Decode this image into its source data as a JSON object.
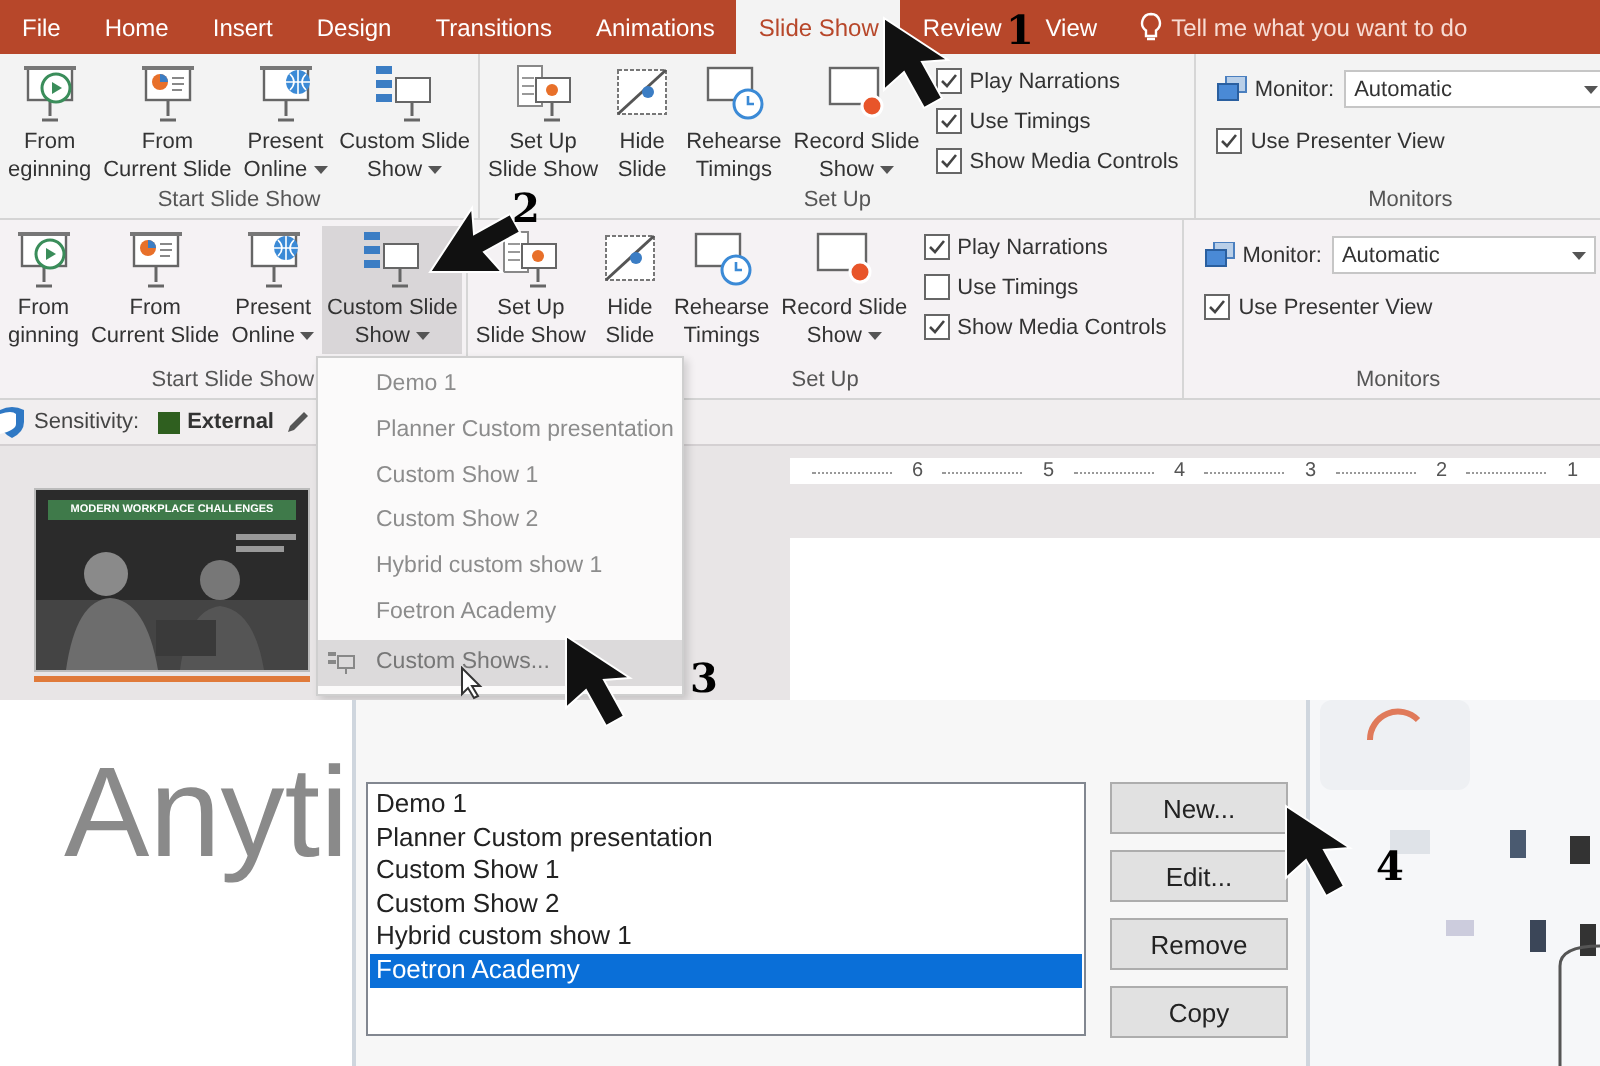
{
  "top_panel": {
    "tabs": [
      {
        "label": "File",
        "selected": false
      },
      {
        "label": "Home",
        "selected": false
      },
      {
        "label": "Insert",
        "selected": false
      },
      {
        "label": "Design",
        "selected": false
      },
      {
        "label": "Transitions",
        "selected": false
      },
      {
        "label": "Animations",
        "selected": false
      },
      {
        "label": "Slide Show",
        "selected": true
      },
      {
        "label": "Review",
        "selected": false
      },
      {
        "label": "View",
        "selected": false
      }
    ],
    "tell_me": {
      "placeholder": "Tell me what you want to do"
    },
    "ribbon": {
      "groups": [
        {
          "label": "Start Slide Show",
          "items": [
            {
              "kind": "button",
              "lines": [
                "From",
                "eginning"
              ],
              "dropdown": false,
              "pressed": false
            },
            {
              "kind": "button",
              "lines": [
                "From",
                "Current Slide"
              ],
              "dropdown": false,
              "pressed": false
            },
            {
              "kind": "button",
              "lines": [
                "Present",
                "Online"
              ],
              "dropdown": true,
              "pressed": false
            },
            {
              "kind": "button",
              "lines": [
                "Custom Slide",
                "Show"
              ],
              "dropdown": true,
              "pressed": false
            }
          ]
        },
        {
          "label": "Set Up",
          "items": [
            {
              "kind": "button",
              "lines": [
                "Set Up",
                "Slide Show"
              ],
              "dropdown": false,
              "pressed": false
            },
            {
              "kind": "button",
              "lines": [
                "Hide",
                "Slide"
              ],
              "dropdown": false,
              "pressed": false
            },
            {
              "kind": "button",
              "lines": [
                "Rehearse",
                "Timings"
              ],
              "dropdown": false,
              "pressed": false
            },
            {
              "kind": "button",
              "lines": [
                "Record Slide",
                "Show"
              ],
              "dropdown": true,
              "pressed": false
            },
            {
              "kind": "checklist",
              "options": [
                {
                  "label": "Play Narrations",
                  "checked": true
                },
                {
                  "label": "Use Timings",
                  "checked": true
                },
                {
                  "label": "Show Media Controls",
                  "checked": true
                }
              ]
            }
          ]
        },
        {
          "label": "Monitors",
          "items": [
            {
              "kind": "monitor",
              "label": "Monitor:",
              "value": "Automatic",
              "options": [
                {
                  "label": "Use Presenter View",
                  "checked": true
                }
              ]
            }
          ]
        }
      ]
    }
  },
  "middle_panel": {
    "ribbon": {
      "groups": [
        {
          "label": "Start Slide Show",
          "items": [
            {
              "kind": "button",
              "lines": [
                "From",
                "ginning"
              ],
              "dropdown": false,
              "pressed": false
            },
            {
              "kind": "button",
              "lines": [
                "From",
                "Current Slide"
              ],
              "dropdown": false,
              "pressed": false
            },
            {
              "kind": "button",
              "lines": [
                "Present",
                "Online"
              ],
              "dropdown": true,
              "pressed": false
            },
            {
              "kind": "button",
              "lines": [
                "Custom Slide",
                "Show"
              ],
              "dropdown": true,
              "pressed": true
            }
          ]
        },
        {
          "label": "Set Up",
          "items": [
            {
              "kind": "button",
              "lines": [
                "Set Up",
                "Slide Show"
              ],
              "dropdown": false,
              "pressed": false
            },
            {
              "kind": "button",
              "lines": [
                "Hide",
                "Slide"
              ],
              "dropdown": false,
              "pressed": false
            },
            {
              "kind": "button",
              "lines": [
                "Rehearse",
                "Timings"
              ],
              "dropdown": false,
              "pressed": false
            },
            {
              "kind": "button",
              "lines": [
                "Record Slide",
                "Show"
              ],
              "dropdown": true,
              "pressed": false
            },
            {
              "kind": "checklist",
              "options": [
                {
                  "label": "Play Narrations",
                  "checked": true
                },
                {
                  "label": "Use Timings",
                  "checked": false
                },
                {
                  "label": "Show Media Controls",
                  "checked": true
                }
              ]
            }
          ]
        },
        {
          "label": "Monitors",
          "items": [
            {
              "kind": "monitor",
              "label": "Monitor:",
              "value": "Automatic",
              "options": [
                {
                  "label": "Use Presenter View",
                  "checked": true
                }
              ]
            }
          ]
        }
      ]
    },
    "sensitivity": {
      "label": "Sensitivity:",
      "value": "External"
    },
    "thumbnail": {
      "title": "MODERN WORKPLACE CHALLENGES"
    },
    "ruler": [
      "6",
      "5",
      "4",
      "3",
      "2",
      "1"
    ],
    "menu": [
      {
        "kind": "show",
        "label": "Demo 1",
        "highlighted": false
      },
      {
        "kind": "show",
        "label": "Planner Custom presentation",
        "highlighted": false
      },
      {
        "kind": "show",
        "label": "Custom Show 1",
        "highlighted": false
      },
      {
        "kind": "show",
        "label": "Custom Show 2",
        "highlighted": false
      },
      {
        "kind": "show",
        "label": "Hybrid custom show 1",
        "highlighted": false
      },
      {
        "kind": "show",
        "label": "Foetron Academy",
        "highlighted": false
      },
      {
        "kind": "command",
        "label": "Custom Shows...",
        "highlighted": true
      }
    ]
  },
  "bottom_panel": {
    "background_text": "Anyti",
    "dialog": {
      "list": [
        {
          "label": "Demo 1",
          "selected": false
        },
        {
          "label": "Planner Custom presentation",
          "selected": false
        },
        {
          "label": "Custom Show 1",
          "selected": false
        },
        {
          "label": "Custom Show 2",
          "selected": false
        },
        {
          "label": "Hybrid custom show 1",
          "selected": false
        },
        {
          "label": "Foetron Academy",
          "selected": true
        }
      ],
      "buttons": [
        "New...",
        "Edit...",
        "Remove",
        "Copy"
      ]
    }
  },
  "annotations": [
    {
      "number": "1"
    },
    {
      "number": "2"
    },
    {
      "number": "3"
    },
    {
      "number": "4"
    }
  ]
}
